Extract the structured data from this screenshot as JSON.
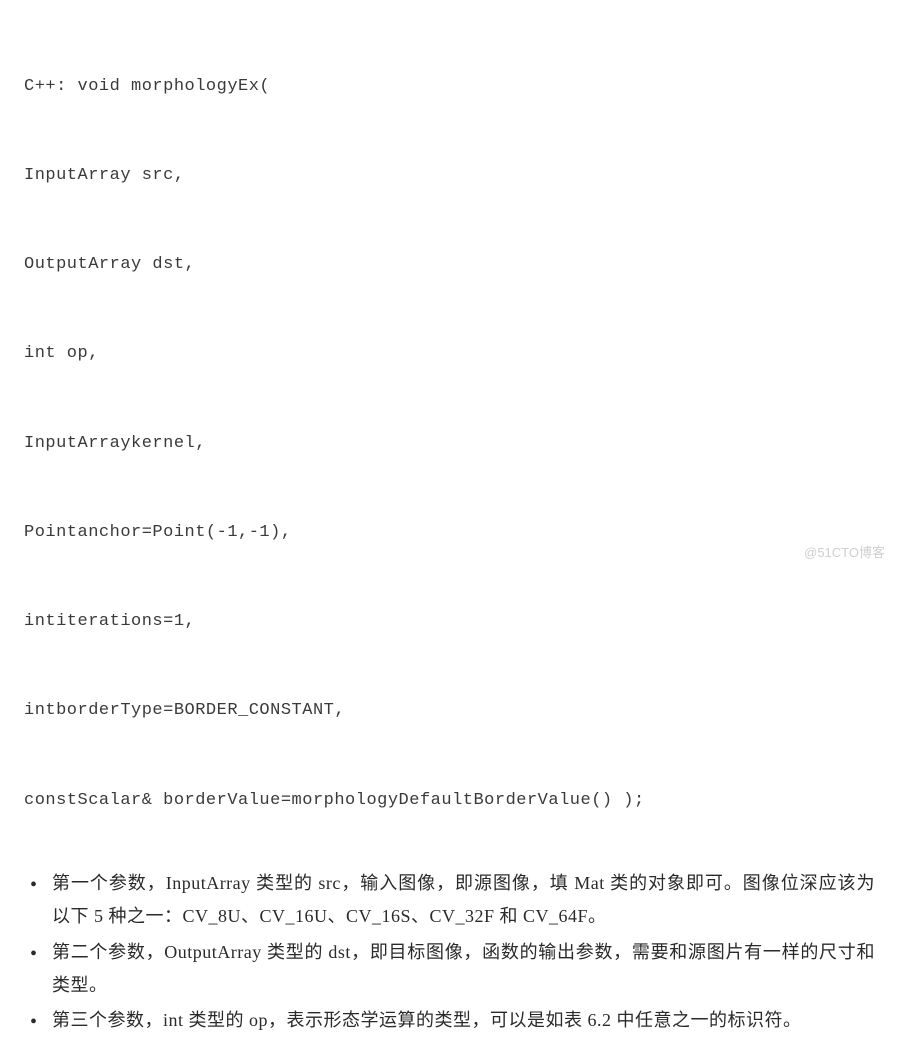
{
  "code": {
    "lines": [
      "C++: void morphologyEx(",
      "InputArray src,",
      "OutputArray dst,",
      "int op,",
      "InputArraykernel,",
      "Pointanchor=Point(-1,-1),",
      "intiterations=1,",
      "intborderType=BORDER_CONSTANT,",
      "constScalar& borderValue=morphologyDefaultBorderValue() );"
    ]
  },
  "bullets": [
    "第一个参数，InputArray 类型的 src，输入图像，即源图像，填 Mat 类的对象即可。图像位深应该为以下 5 种之一：CV_8U、CV_16U、CV_16S、CV_32F 和 CV_64F。",
    "第二个参数，OutputArray 类型的 dst，即目标图像，函数的输出参数，需要和源图片有一样的尺寸和类型。",
    "第三个参数，int 类型的 op，表示形态学运算的类型，可以是如表 6.2 中任意之一的标识符。"
  ],
  "watermark": "@51CTO博客"
}
